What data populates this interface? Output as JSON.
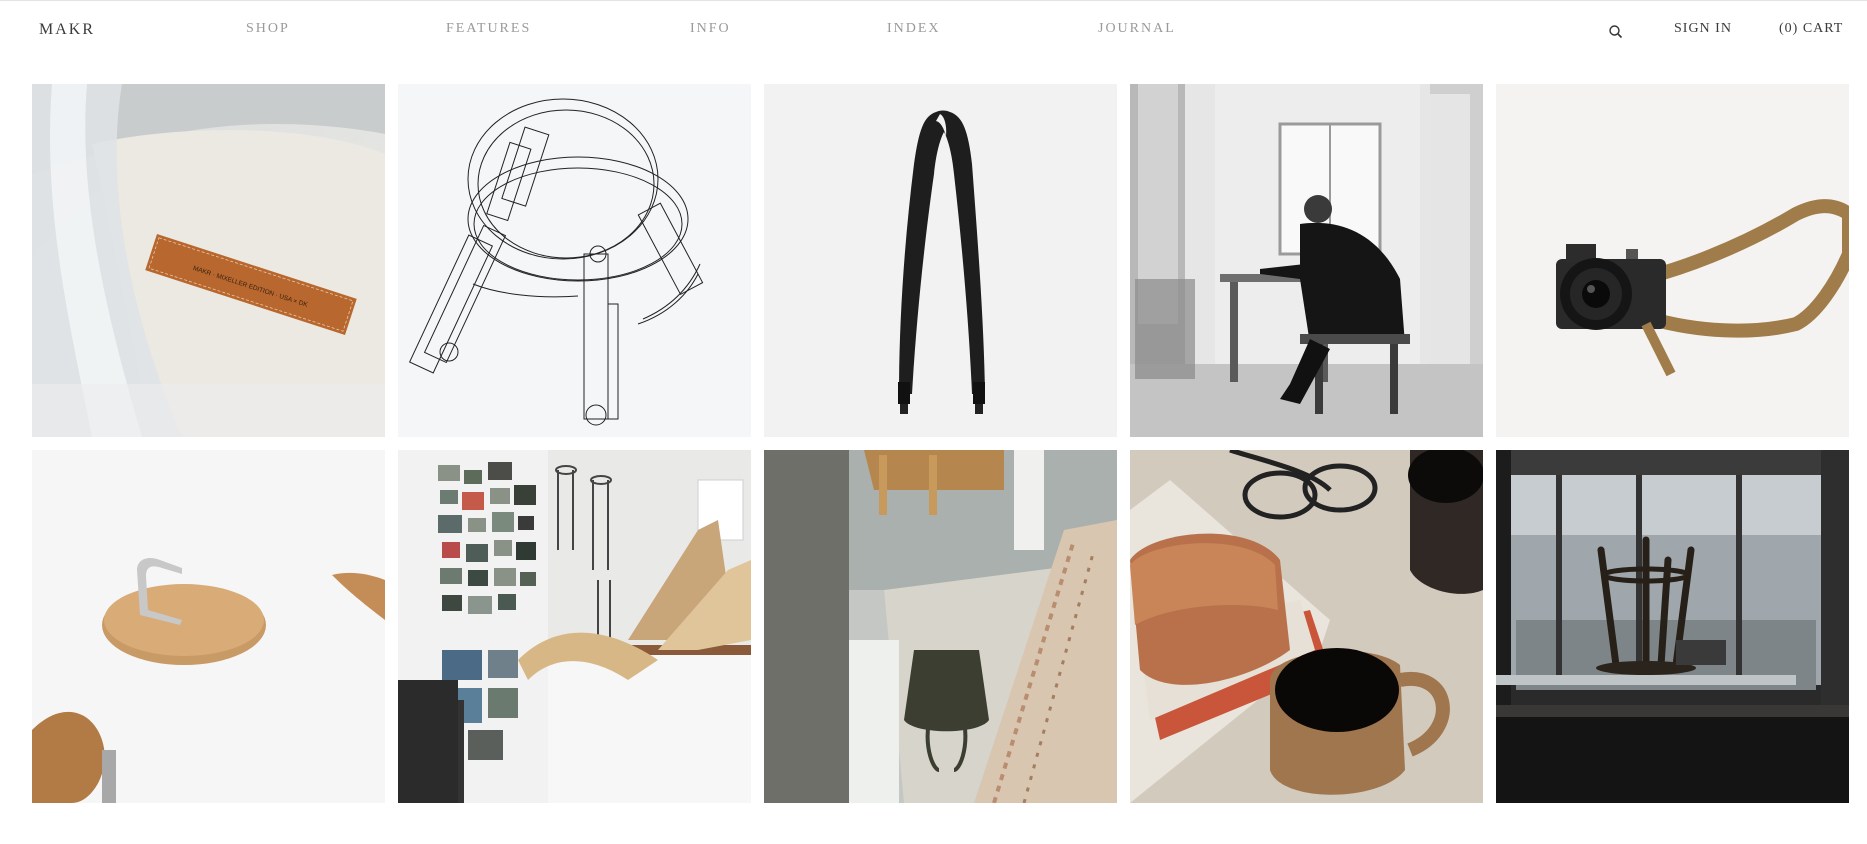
{
  "header": {
    "logo": "MAKR",
    "nav": [
      "SHOP",
      "FEATURES",
      "INFO",
      "INDEX",
      "JOURNAL"
    ],
    "search_icon": "search-icon",
    "sign_in": "SIGN IN",
    "cart": "(0) CART"
  },
  "grid": {
    "tiles": [
      {
        "name": "canvas-bag-leather-label",
        "label_text": "MAKR · MIXELLER EDITION · USA × DK"
      },
      {
        "name": "stool-technical-drawing"
      },
      {
        "name": "black-camera-strap"
      },
      {
        "name": "man-working-at-desk"
      },
      {
        "name": "camera-with-tan-strap"
      },
      {
        "name": "wooden-stool-hook"
      },
      {
        "name": "studio-moodboard-wall"
      },
      {
        "name": "olive-tote-bag-on-rug"
      },
      {
        "name": "leather-wallet-and-coffee"
      },
      {
        "name": "stool-in-window-silhouette"
      }
    ]
  },
  "colors": {
    "nav_text": "#9a9a9a",
    "dark_text": "#3b3b3b",
    "leather": "#b8672e",
    "tan_strap": "#a07c4a"
  }
}
